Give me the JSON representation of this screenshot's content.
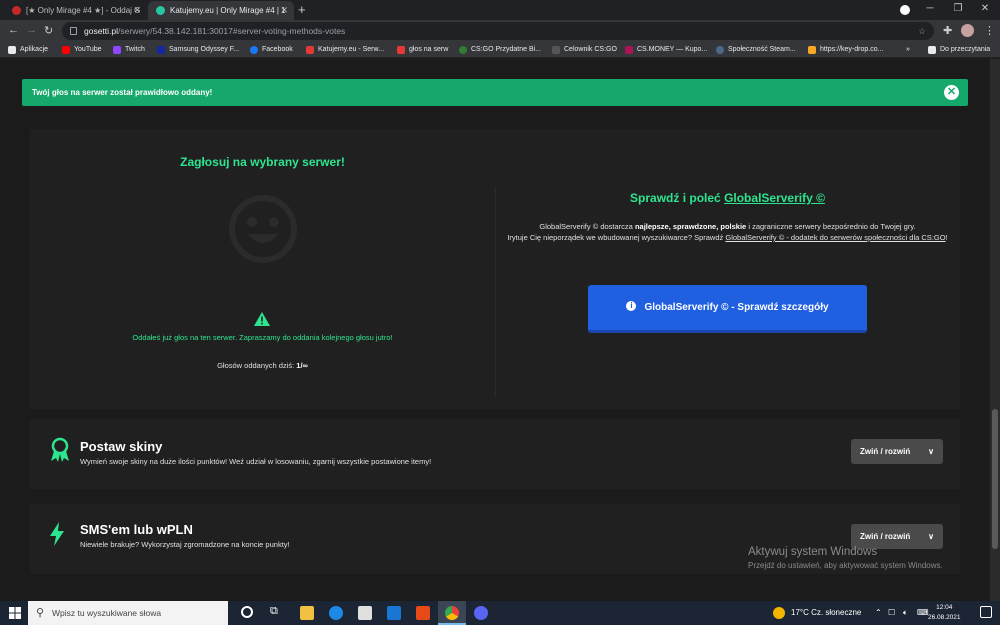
{
  "browser": {
    "tabs": [
      {
        "title": "[★ Only Mirage #4 ★] - Oddaj G"
      },
      {
        "title": "Katujemy.eu | Only Mirage #4 | 1"
      }
    ],
    "new_tab": "+",
    "url_host": "gosetti.pl",
    "url_path": "/serwery/54.38.142.181:30017#server-voting-methods-votes",
    "bookmarks": [
      {
        "label": "Aplikacje",
        "color": "#e8eaed"
      },
      {
        "label": "YouTube",
        "color": "#ff0000"
      },
      {
        "label": "Twitch",
        "color": "#9146ff"
      },
      {
        "label": "Samsung Odyssey F...",
        "color": "#1428a0"
      },
      {
        "label": "Facebook",
        "color": "#1877f2"
      },
      {
        "label": "Katujemy.eu - Serw...",
        "color": "#e53935"
      },
      {
        "label": "głos na serw",
        "color": "#e53935"
      },
      {
        "label": "CS:GO Przydatne Bi...",
        "color": "#2e7d32"
      },
      {
        "label": "Celownik CS:GO",
        "color": "#555555"
      },
      {
        "label": "CS.MONEY — Kupo...",
        "color": "#ad1457"
      },
      {
        "label": "Społeczność Steam...",
        "color": "#1b2838"
      },
      {
        "label": "https://key-drop.co...",
        "color": "#f9a825"
      },
      {
        "label": "Do przeczytania",
        "color": "#e8eaed"
      }
    ],
    "bookmarks_more": "»"
  },
  "alert": {
    "text": "Twój głos na serwer został prawidłowo oddany!",
    "close": "✕"
  },
  "vote": {
    "title": "Zagłosuj na wybrany serwer!",
    "voted_msg": "Oddałeś już głos na ten serwer. Zapraszamy do oddania kolejnego głosu jutro!",
    "count_label": "Głosów oddanych dziś:",
    "count_value": "1/∞"
  },
  "globalserverify": {
    "title_prefix": "Sprawdź i poleć",
    "title_link": "GlobalServerify ©",
    "desc_1": "GlobalServerify © dostarcza ",
    "desc_bold": "najlepsze, sprawdzone, polskie",
    "desc_2": " i zagraniczne serwery bezpośrednio do Twojej gry.",
    "desc_3": "Irytuje Cię nieporządek we wbudowanej wyszukiwarce? Sprawdź ",
    "desc_link": "GlobalServerify © - dodatek do serwerów społeczności dla CS:GO",
    "desc_4": "!",
    "button": "GlobalServerify © - Sprawdź szczegóły"
  },
  "sections": [
    {
      "title": "Postaw skiny",
      "subtitle": "Wymień swoje skiny na duże ilości punktów! Weź udział w losowaniu, zgarnij wszystkie postawione itemy!",
      "toggle": "Zwiń / rozwiń"
    },
    {
      "title": "SMS'em lub wPLN",
      "subtitle": "Niewiele brakuje? Wykorzystaj zgromadzone na koncie punkty!",
      "toggle": "Zwiń / rozwiń"
    }
  ],
  "watermark": {
    "line1": "Aktywuj system Windows",
    "line2": "Przejdź do ustawień, aby aktywować system Windows."
  },
  "taskbar": {
    "search_placeholder": "Wpisz tu wyszukiwane słowa",
    "weather": "17°C  Cz. słoneczne",
    "time": "12:04",
    "date": "26.08.2021"
  },
  "colors": {
    "accent_green": "#2ee58f",
    "alert_green": "#16a86b",
    "button_blue": "#1f5fe0"
  }
}
